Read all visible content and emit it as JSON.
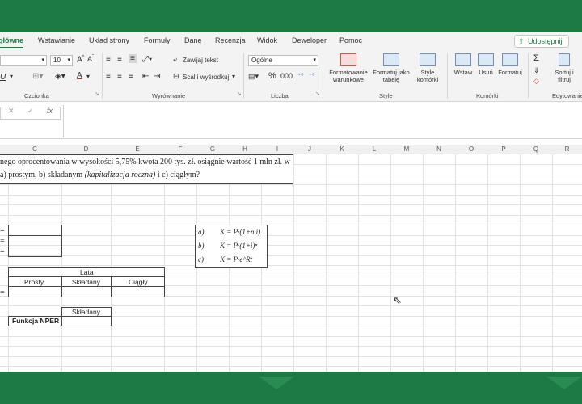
{
  "ribbon": {
    "tabs": [
      "główne",
      "Wstawianie",
      "Układ strony",
      "Formuły",
      "Dane",
      "Recenzja",
      "Widok",
      "Deweloper",
      "Pomoc"
    ],
    "share_label": "Udostępnij",
    "font_size": "10",
    "wrap_text": "Zawijaj tekst",
    "merge_center": "Scal i wyśrodkuj",
    "number_format": "Ogólne",
    "cond_format": "Formatowanie warunkowe",
    "format_table": "Formatuj jako tabelę",
    "cell_styles": "Style komórki",
    "insert": "Wstaw",
    "delete": "Usuń",
    "format": "Formatuj",
    "sort_filter": "Sortuj i filtruj",
    "groups": {
      "font": "Czcionka",
      "alignment": "Wyrównanie",
      "number": "Liczba",
      "styles": "Style",
      "cells": "Komórki",
      "editing": "Edytowanie"
    }
  },
  "formula_bar": {
    "fx": "fx"
  },
  "columns": [
    "C",
    "D",
    "E",
    "F",
    "G",
    "H",
    "I",
    "J",
    "K",
    "L",
    "M",
    "N",
    "O",
    "P",
    "Q",
    "R"
  ],
  "sheet": {
    "question_line1": "nego oprocentowania w wysokości 5,75% kwota 200 tys. zł. osiągnie wartość 1 mln zł. w",
    "question_line2_a": "a) prostym, b) składanym ",
    "question_line2_b": "(kapitalizacja roczna)",
    "question_line2_c": "  i c) ciągłym?",
    "eq_marks": [
      "=",
      "=",
      "="
    ],
    "lata_header": "Lata",
    "col_prosty": "Prosty",
    "col_skladany": "Składany",
    "col_ciagly": "Ciągły",
    "row_eq": "=",
    "skladany2": "Składany",
    "nper_label": "Funkcja NPER",
    "formulas": [
      {
        "label": "a)",
        "expr": "K = P·(1+n·i)"
      },
      {
        "label": "b)",
        "expr": "K = P·(1+i)ⁿ"
      },
      {
        "label": "c)",
        "expr": "K = P·e^Rt"
      }
    ]
  }
}
